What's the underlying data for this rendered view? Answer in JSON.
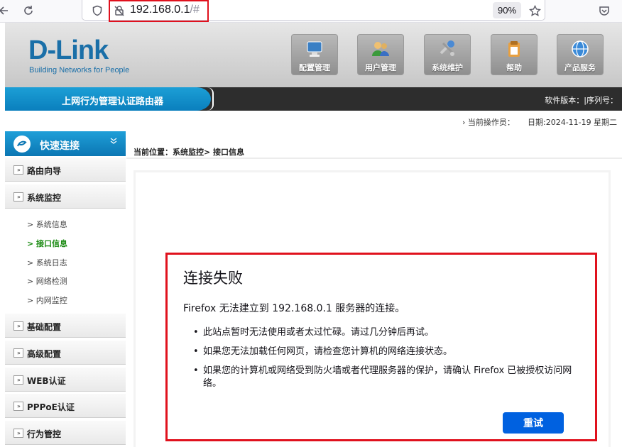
{
  "browser": {
    "url_host": "192.168.0.1",
    "url_path": "/#",
    "zoom": "90%"
  },
  "header": {
    "logo": "D-Link",
    "logo_tagline": "Building Networks for People",
    "menu": [
      {
        "label": "配置管理",
        "icon": "computer-icon"
      },
      {
        "label": "用户管理",
        "icon": "users-icon"
      },
      {
        "label": "系统维护",
        "icon": "tools-icon"
      },
      {
        "label": "帮助",
        "icon": "clipboard-icon"
      },
      {
        "label": "产品服务",
        "icon": "globe-icon"
      }
    ]
  },
  "title_bar": {
    "title": "上网行为管理认证路由器",
    "version": "软件版本：|序列号："
  },
  "info_line": {
    "operator": "› 当前操作员：",
    "date": "日期:2024-11-19",
    "weekday": "星期二"
  },
  "sidebar": {
    "quick_connect": "快速连接",
    "items": [
      {
        "label": "路由向导"
      },
      {
        "label": "系统监控"
      },
      {
        "label": "基础配置"
      },
      {
        "label": "高级配置"
      },
      {
        "label": "WEB认证"
      },
      {
        "label": "PPPoE认证"
      },
      {
        "label": "行为管控"
      }
    ],
    "sub_items": [
      {
        "label": "> 系统信息"
      },
      {
        "label": "> 接口信息"
      },
      {
        "label": "> 系统日志"
      },
      {
        "label": "> 网络检测"
      },
      {
        "label": "> 内网监控"
      }
    ],
    "arrow_glyph": "»"
  },
  "content": {
    "breadcrumb": "当前位置：系统监控> 接口信息"
  },
  "error": {
    "title": "连接失败",
    "description": "Firefox 无法建立到 192.168.0.1 服务器的连接。",
    "bullets": [
      "此站点暂时无法使用或者太过忙碌。请过几分钟后再试。",
      "如果您无法加载任何网页，请检查您计算机的网络连接状态。",
      "如果您的计算机或网络受到防火墙或者代理服务器的保护，请确认 Firefox 已被授权访问网络。"
    ],
    "retry_label": "重试"
  },
  "colors": {
    "highlight_border": "#e0111d",
    "primary_blue": "#0061e0",
    "dlink_blue": "#1a6fa8",
    "active_green": "#1a8a12"
  }
}
